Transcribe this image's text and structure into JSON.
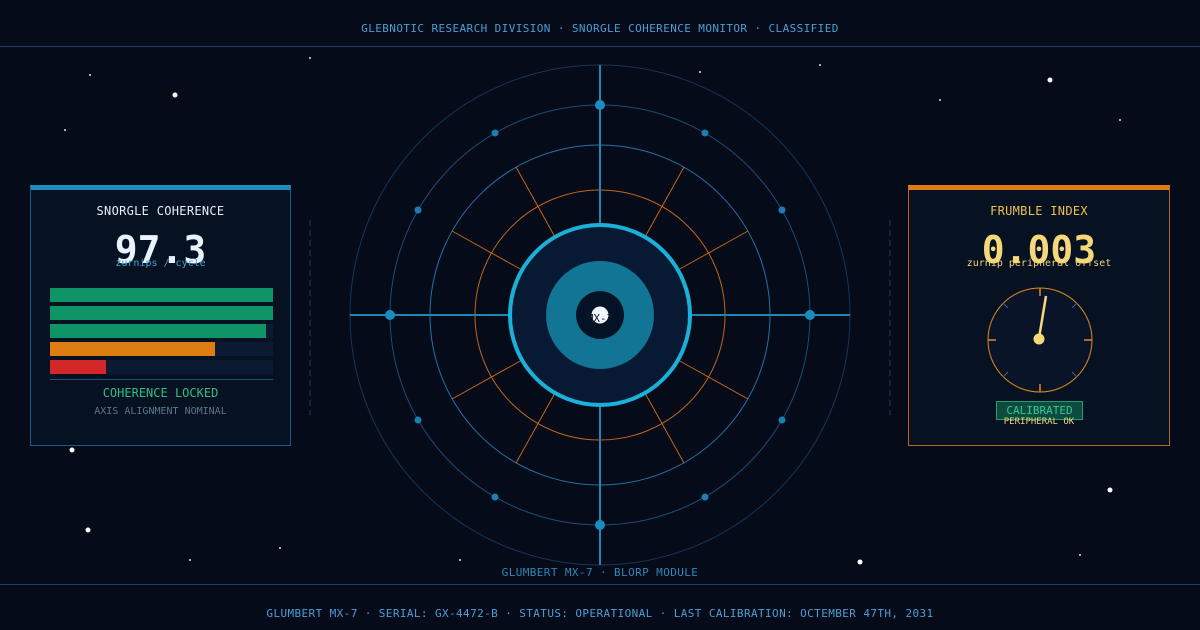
{
  "header": {
    "title": "GLEBNOTIC RESEARCH DIVISION  ·  SNORGLE COHERENCE MONITOR  ·  CLASSIFIED"
  },
  "radar": {
    "core_label": "MX-7",
    "caption": "GLUMBERT MX-7  ·  BLORP MODULE"
  },
  "left_panel": {
    "title": "SNORGLE COHERENCE",
    "value": "97.3",
    "unit": "zurnips / cycle",
    "bars": [
      {
        "level": 1.0,
        "color": "#0e9466"
      },
      {
        "level": 1.0,
        "color": "#0e9466"
      },
      {
        "level": 0.97,
        "color": "#0e9466"
      },
      {
        "level": 0.74,
        "color": "#de7d12"
      },
      {
        "level": 0.25,
        "color": "#d42828"
      }
    ],
    "status": "COHERENCE LOCKED",
    "substatus": "AXIS ALIGNMENT NOMINAL"
  },
  "right_panel": {
    "title": "FRUMBLE INDEX",
    "value": "0.003",
    "unit": "zurnip peripheral offset",
    "badge": "CALIBRATED",
    "badge_sub": "PERIPHERAL OK"
  },
  "footer": {
    "text": "GLUMBERT MX-7  ·  SERIAL: GX-4472-B  ·  STATUS: OPERATIONAL  ·  LAST CALIBRATION: OCTEMBER 47TH, 2031"
  },
  "colors": {
    "background": "#050b18",
    "cyan_accent": "#1ab0d8",
    "orange_accent": "#e07a16",
    "green_status": "#2fbf87",
    "gold_text": "#f6d77a"
  },
  "icons": [
    "radar-core-icon",
    "dial-gauge-icon"
  ]
}
